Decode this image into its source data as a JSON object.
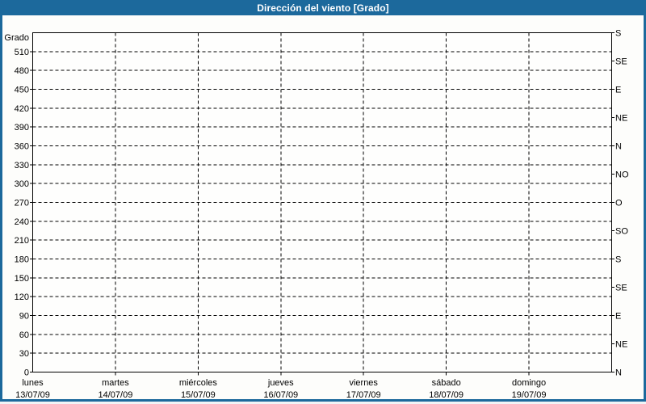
{
  "window": {
    "title": "Dirección del viento [Grado]"
  },
  "colors": {
    "titlebar_bg": "#1c699c",
    "window_border": "#1c699c",
    "title_text": "#ffffff",
    "plot_bg": "#fefefd",
    "grid_line": "#000000",
    "axis_line": "#000000",
    "label_text": "#000000"
  },
  "chart_data": {
    "type": "line",
    "title": "Dirección del viento [Grado]",
    "grid": {
      "style": "dashed",
      "horizontal_step_deg": 30,
      "vertical": "one line per day boundary"
    },
    "legend": "none",
    "y_left": {
      "axis_title": "Grado",
      "min": 0,
      "max": 540,
      "tick_step": 30,
      "tick_labels": [
        "0",
        "30",
        "60",
        "90",
        "120",
        "150",
        "180",
        "210",
        "240",
        "270",
        "300",
        "330",
        "360",
        "390",
        "420",
        "450",
        "480",
        "510"
      ]
    },
    "y_right": {
      "tick_step_deg": 45,
      "ticks": [
        {
          "value": 0,
          "label": "N"
        },
        {
          "value": 45,
          "label": "NE"
        },
        {
          "value": 90,
          "label": "E"
        },
        {
          "value": 135,
          "label": "SE"
        },
        {
          "value": 180,
          "label": "S"
        },
        {
          "value": 225,
          "label": "SO"
        },
        {
          "value": 270,
          "label": "O"
        },
        {
          "value": 315,
          "label": "NO"
        },
        {
          "value": 360,
          "label": "N"
        },
        {
          "value": 405,
          "label": "NE"
        },
        {
          "value": 450,
          "label": "E"
        },
        {
          "value": 495,
          "label": "SE"
        },
        {
          "value": 540,
          "label": "S"
        }
      ]
    },
    "x": {
      "days": [
        {
          "name": "lunes",
          "date": "13/07/09"
        },
        {
          "name": "martes",
          "date": "14/07/09"
        },
        {
          "name": "miércoles",
          "date": "15/07/09"
        },
        {
          "name": "jueves",
          "date": "16/07/09"
        },
        {
          "name": "viernes",
          "date": "17/07/09"
        },
        {
          "name": "sábado",
          "date": "18/07/09"
        },
        {
          "name": "domingo",
          "date": "19/07/09"
        }
      ]
    },
    "series": []
  }
}
